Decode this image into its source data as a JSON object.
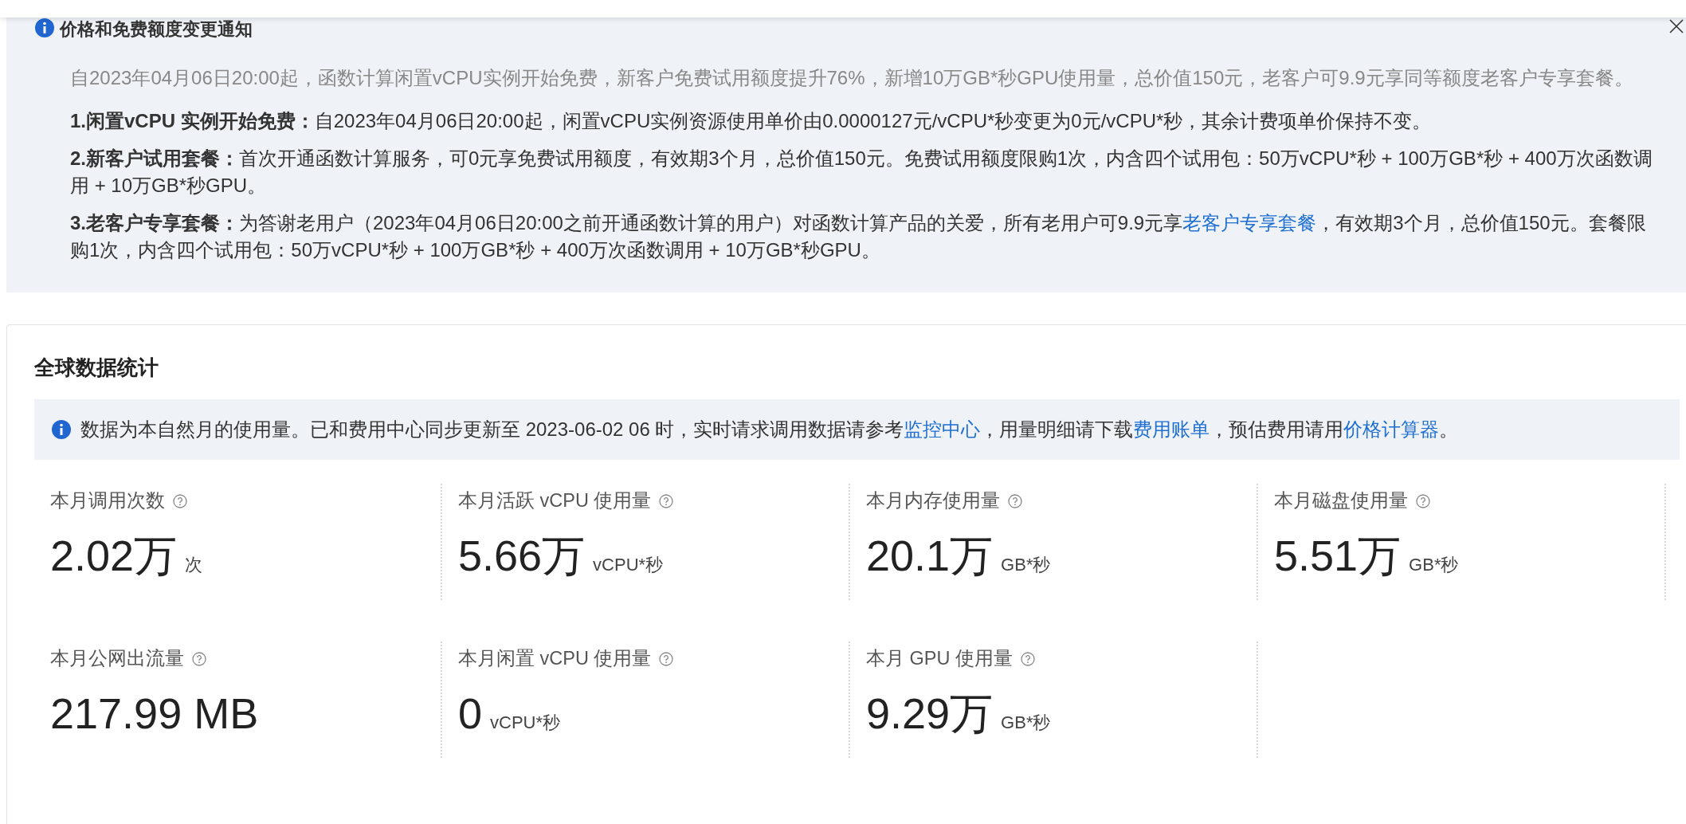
{
  "notice": {
    "title": "价格和免费额度变更通知",
    "closable": true,
    "intro": "自2023年04月06日20:00起，函数计算闲置vCPU实例开始免费，新客户免费试用额度提升76%，新增10万GB*秒GPU使用量，总价值150元，老客户可9.9元享同等额度老客户专享套餐。",
    "items": [
      {
        "heading": "1.闲置vCPU 实例开始免费：",
        "segments": [
          {
            "kind": "text",
            "text": "自2023年04月06日20:00起，闲置vCPU实例资源使用单价由0.0000127元/vCPU*秒变更为0元/vCPU*秒，其余计费项单价保持不变。"
          }
        ]
      },
      {
        "heading": "2.新客户试用套餐：",
        "segments": [
          {
            "kind": "text",
            "text": "首次开通函数计算服务，可0元享免费试用额度，有效期3个月，总价值150元。免费试用额度限购1次，内含四个试用包：50万vCPU*秒 + 100万GB*秒 + 400万次函数调用 + 10万GB*秒GPU。"
          }
        ]
      },
      {
        "heading": "3.老客户专享套餐：",
        "segments": [
          {
            "kind": "text",
            "text": "为答谢老用户（2023年04月06日20:00之前开通函数计算的用户）对函数计算产品的关爱，所有老用户可9.9元享"
          },
          {
            "kind": "link",
            "text": "老客户专享套餐"
          },
          {
            "kind": "text",
            "text": "，有效期3个月，总价值150元。套餐限购1次，内含四个试用包：50万vCPU*秒 + 100万GB*秒 + 400万次函数调用 + 10万GB*秒GPU。"
          }
        ]
      }
    ]
  },
  "stats": {
    "title": "全球数据统计",
    "info": [
      {
        "kind": "text",
        "text": "数据为本自然月的使用量。已和费用中心同步更新至 2023-06-02 06 时，实时请求调用数据请参考"
      },
      {
        "kind": "link",
        "text": "监控中心"
      },
      {
        "kind": "text",
        "text": "，用量明细请下载"
      },
      {
        "kind": "link",
        "text": "费用账单"
      },
      {
        "kind": "text",
        "text": "，预估费用请用"
      },
      {
        "kind": "link",
        "text": "价格计算器"
      },
      {
        "kind": "text",
        "text": "。"
      }
    ],
    "metrics": [
      {
        "label": "本月调用次数",
        "value": "2.02万",
        "unit": "次"
      },
      {
        "label": "本月活跃 vCPU 使用量",
        "value": "5.66万",
        "unit": "vCPU*秒"
      },
      {
        "label": "本月内存使用量",
        "value": "20.1万",
        "unit": "GB*秒"
      },
      {
        "label": "本月磁盘使用量",
        "value": "5.51万",
        "unit": "GB*秒"
      },
      {
        "label": "本月公网出流量",
        "value": "217.99 MB"
      },
      {
        "label": "本月闲置 vCPU 使用量",
        "value": "0",
        "unit": "vCPU*秒"
      },
      {
        "label": "本月 GPU 使用量",
        "value": "9.29万",
        "unit": "GB*秒"
      }
    ]
  }
}
